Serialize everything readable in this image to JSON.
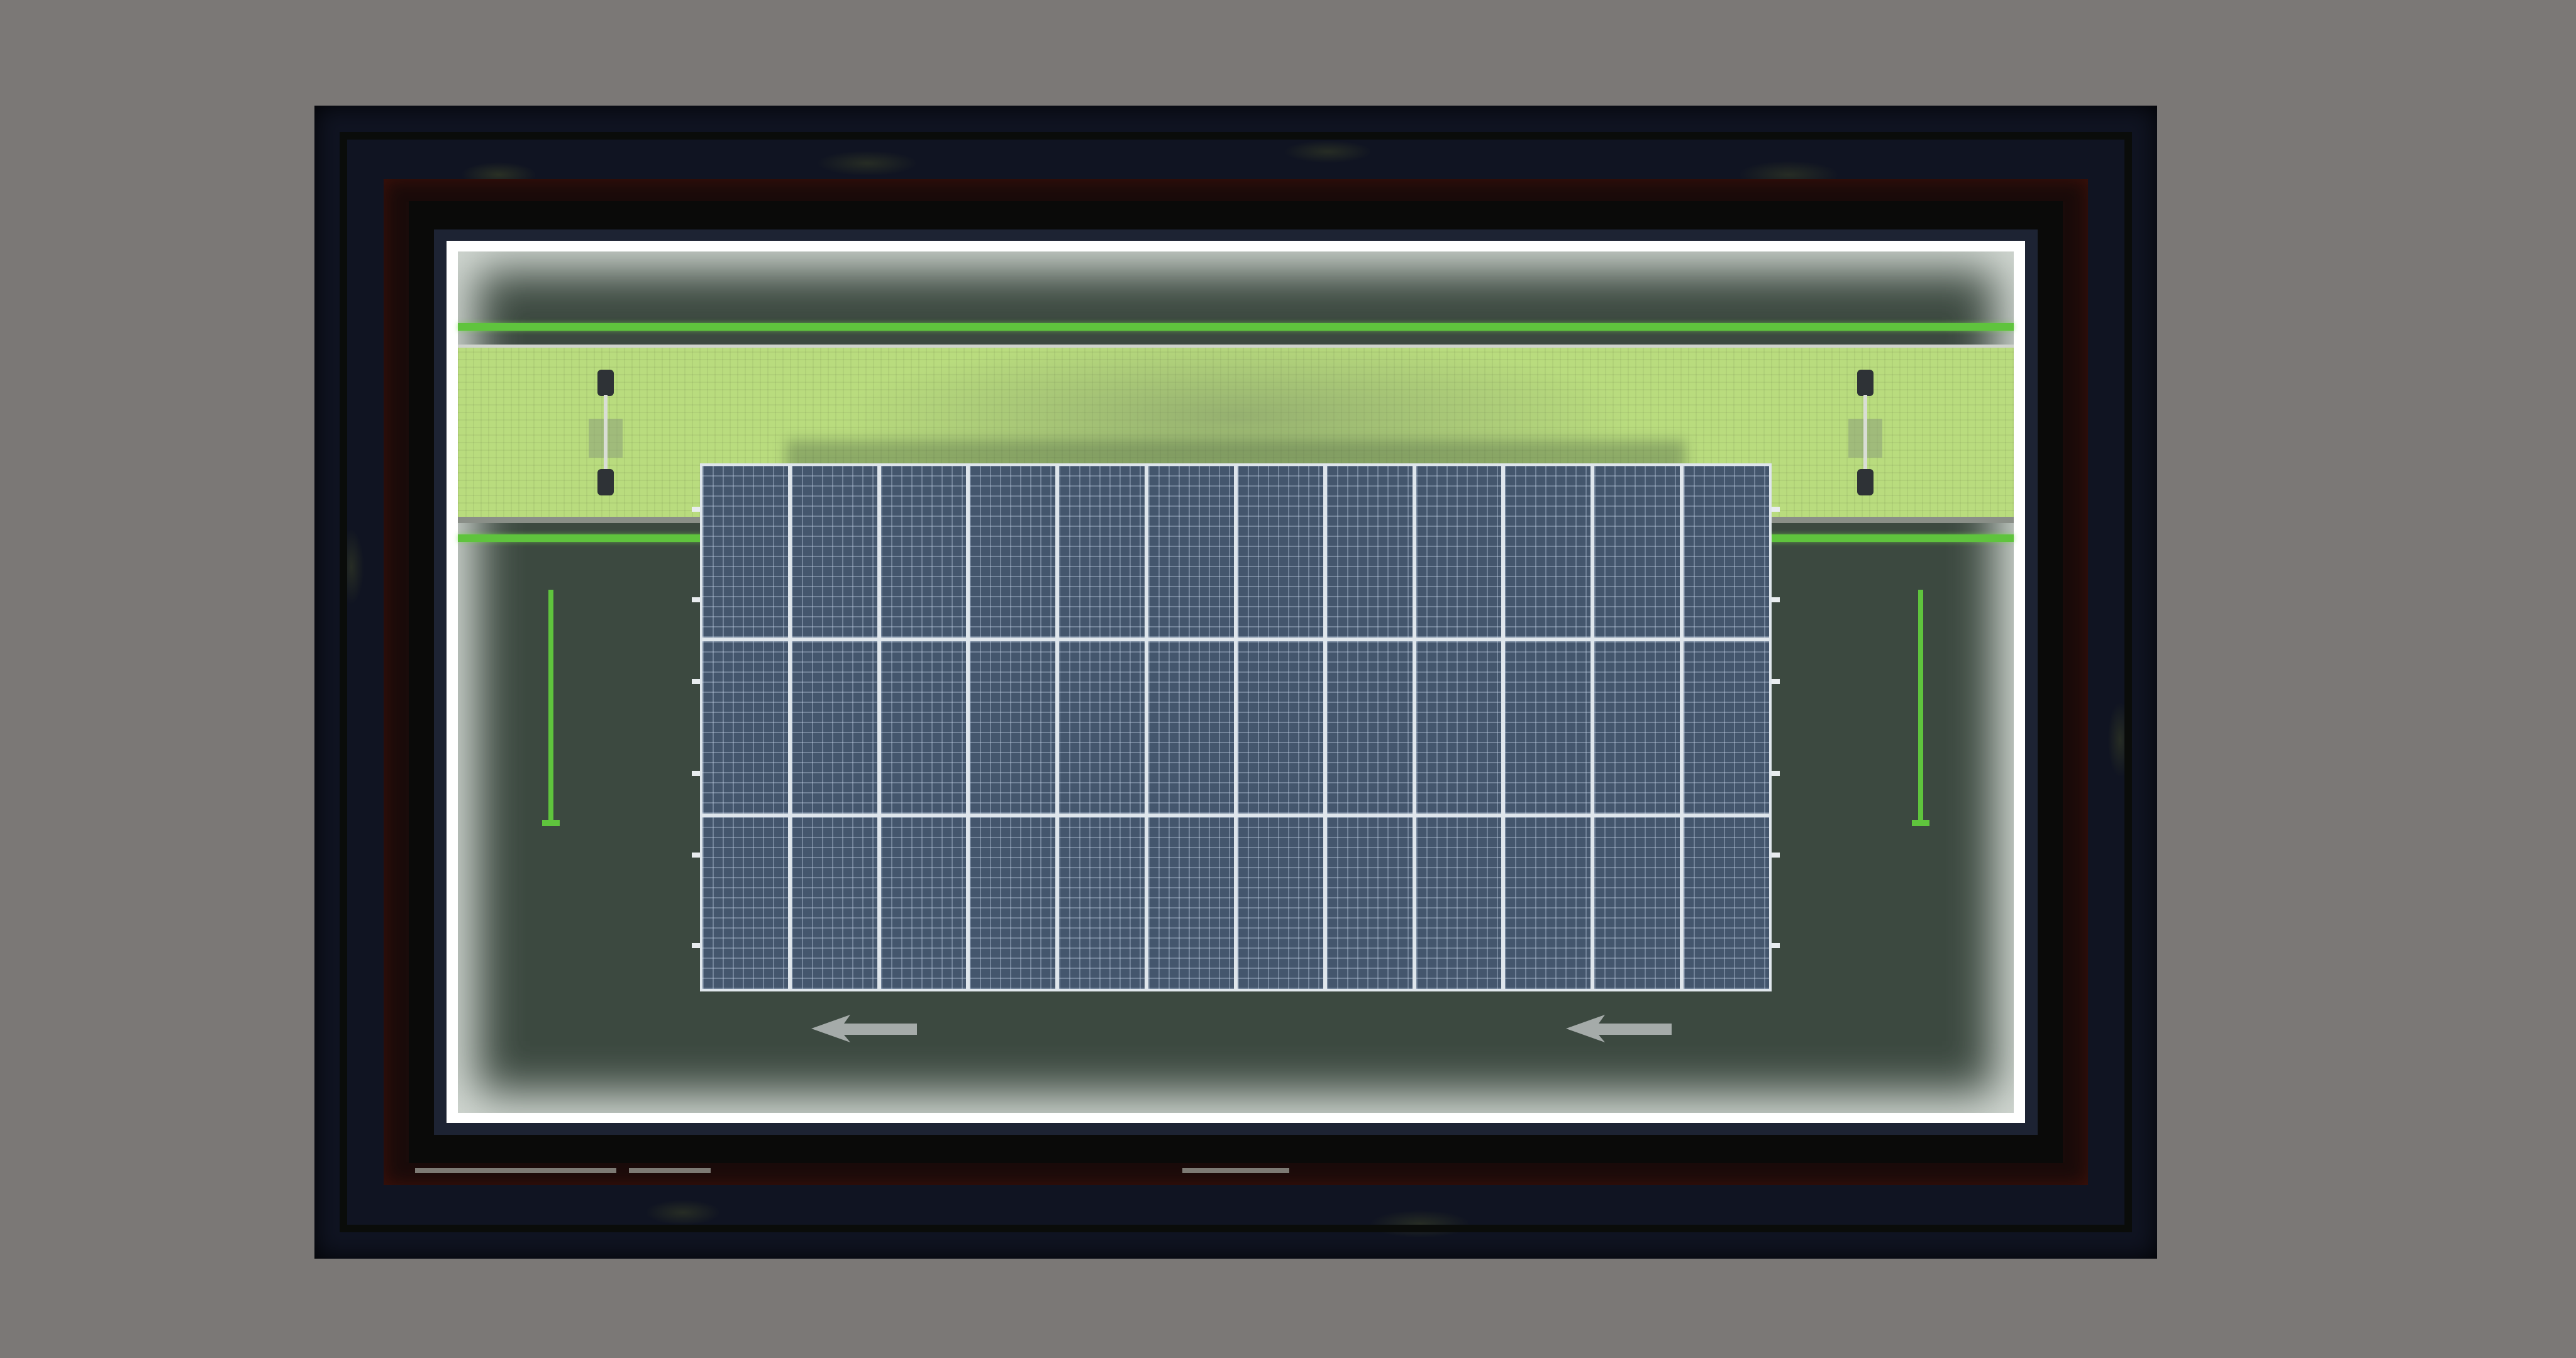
{
  "scene": {
    "colors": {
      "background": "#7b7876",
      "frame_outer": "#101422",
      "frame_red": "#1a0b0a",
      "frame_navy": "#1d2333",
      "lot_glow": "#ffffff",
      "lot_surface": "#3c4940",
      "walkway": "#b9dc7e",
      "line_green": "#5fc43d",
      "panel": "#44566d",
      "panel_grid": "#dfe6ec",
      "arrow": "#b7bcbc"
    },
    "solar_array": {
      "columns": 12,
      "rows": 3
    },
    "chargers": [
      "charger-icon",
      "charger-icon"
    ],
    "arrows": [
      "arrow-left-icon",
      "arrow-left-icon"
    ]
  }
}
